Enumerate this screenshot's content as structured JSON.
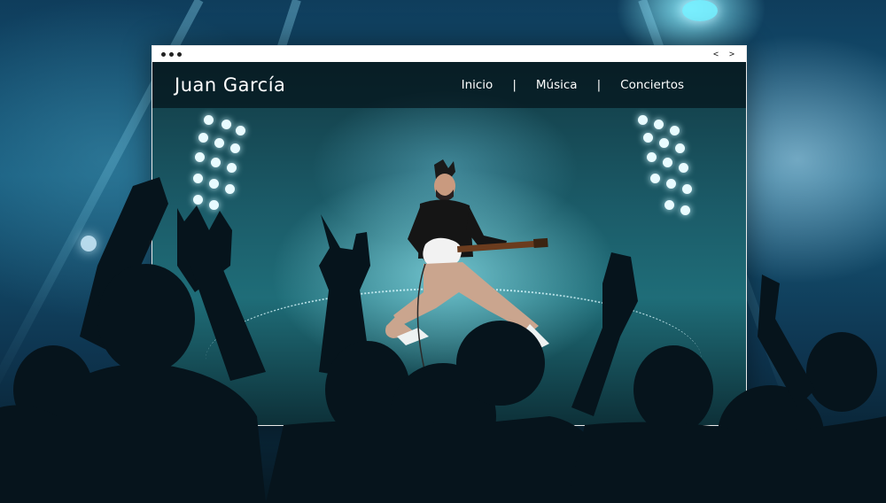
{
  "site": {
    "brand": "Juan García",
    "nav": [
      {
        "label": "Inicio"
      },
      {
        "label": "Música"
      },
      {
        "label": "Conciertos"
      }
    ],
    "separator": "|"
  },
  "browser": {
    "window_dots": 3,
    "nav_arrows": "< >"
  },
  "colors": {
    "accent_teal": "#1f6d78",
    "header_bg": "#04141a",
    "text": "#ffffff"
  }
}
